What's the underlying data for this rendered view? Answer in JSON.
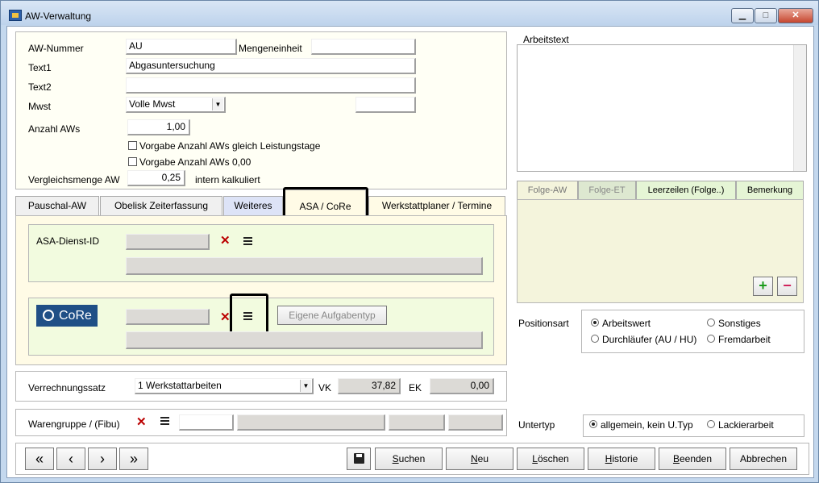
{
  "window": {
    "title": "AW-Verwaltung"
  },
  "form": {
    "aw_nummer_label": "AW-Nummer",
    "aw_nummer_value": "AU",
    "mengeneinheit_label": "Mengeneinheit",
    "mengeneinheit_value": "",
    "text1_label": "Text1",
    "text1_value": "Abgasuntersuchung",
    "text2_label": "Text2",
    "text2_value": "",
    "mwst_label": "Mwst",
    "mwst_value": "Volle Mwst",
    "anzahl_label": "Anzahl AWs",
    "anzahl_value": "1,00",
    "cb1_label": "Vorgabe Anzahl AWs gleich Leistungstage",
    "cb2_label": "Vorgabe Anzahl AWs 0,00",
    "vergleich_label": "Vergleichsmenge AW",
    "vergleich_value": "0,25",
    "intern_label": "intern kalkuliert"
  },
  "tabs": [
    "Pauschal-AW",
    "Obelisk Zeiterfassung",
    "Weiteres",
    "ASA / CoRe",
    "Werkstattplaner / Termine"
  ],
  "asa": {
    "dienst_label": "ASA-Dienst-ID",
    "core_logo": "CoRe",
    "eigene_button": "Eigene Aufgabentyp"
  },
  "arbeitstext": {
    "label": "Arbeitstext"
  },
  "folge_tabs": [
    "Folge-AW",
    "Folge-ET",
    "Leerzeilen (Folge..)",
    "Bemerkung"
  ],
  "positionsart": {
    "label": "Positionsart",
    "options": [
      "Arbeitswert",
      "Sonstiges",
      "Durchläufer (AU / HU)",
      "Fremdarbeit"
    ]
  },
  "verrechnung": {
    "label": "Verrechnungssatz",
    "value": "1 Werkstattarbeiten",
    "vk_label": "VK",
    "vk_value": "37,82",
    "ek_label": "EK",
    "ek_value": "0,00"
  },
  "warengruppe": {
    "label": "Warengruppe / (Fibu)"
  },
  "untertyp": {
    "label": "Untertyp",
    "options": [
      "allgemein, kein U.Typ",
      "Lackierarbeit"
    ]
  },
  "nav": [
    "«",
    "‹",
    "›",
    "»"
  ],
  "buttons": {
    "suchen": "Suchen",
    "neu": "Neu",
    "loeschen": "Löschen",
    "historie": "Historie",
    "beenden": "Beenden",
    "abbrechen": "Abbrechen"
  },
  "colors": {
    "panel_green": "#f2fbdf",
    "tab_blue": "#dde3f7",
    "tab_active": "#fffbe6",
    "folge_panel": "#f4f4dc"
  }
}
